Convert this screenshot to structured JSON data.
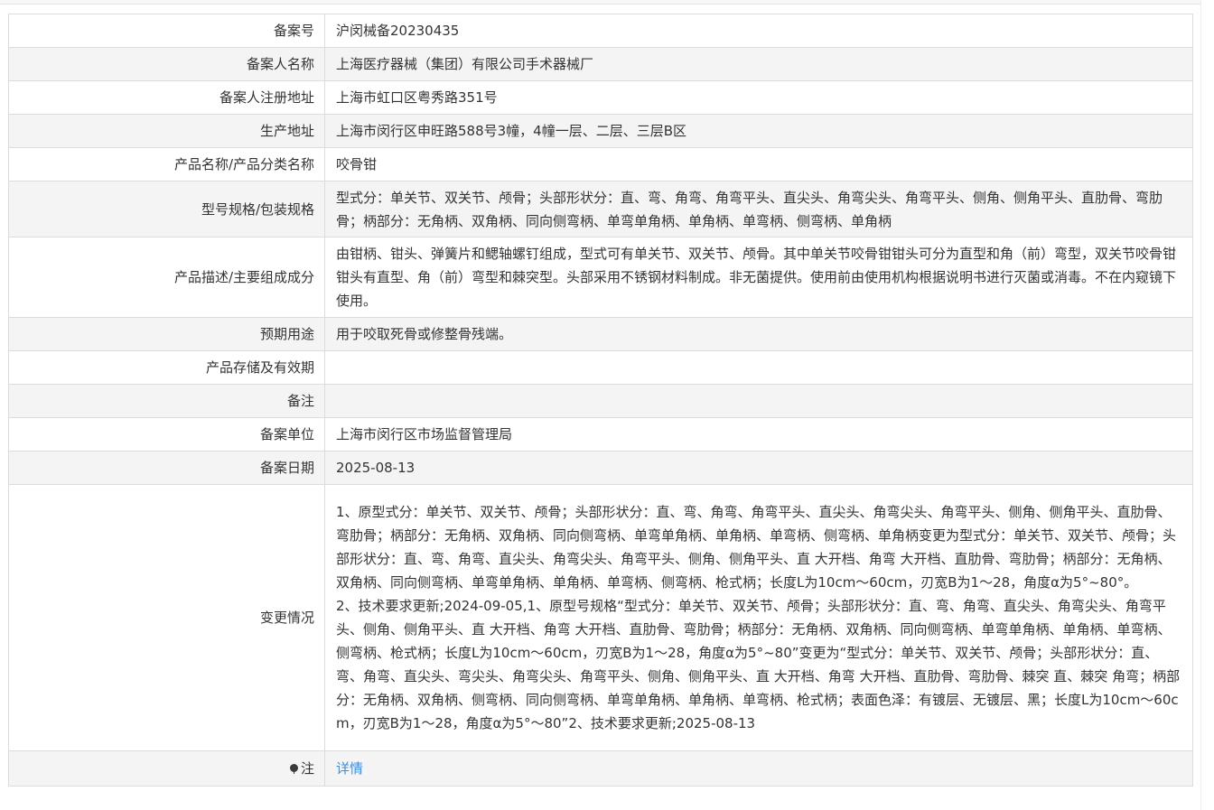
{
  "rows": [
    {
      "label": "备案号",
      "value": "沪闵械备20230435"
    },
    {
      "label": "备案人名称",
      "value": "上海医疗器械（集团）有限公司手术器械厂"
    },
    {
      "label": "备案人注册地址",
      "value": "上海市虹口区粤秀路351号"
    },
    {
      "label": "生产地址",
      "value": "上海市闵行区申旺路588号3幢，4幢一层、二层、三层B区"
    },
    {
      "label": "产品名称/产品分类名称",
      "value": "咬骨钳"
    },
    {
      "label": "型号规格/包装规格",
      "value": "型式分：单关节、双关节、颅骨；头部形状分：直、弯、角弯、角弯平头、直尖头、角弯尖头、角弯平头、侧角、侧角平头、直肋骨、弯肋骨；柄部分：无角柄、双角柄、同向侧弯柄、单弯单角柄、单角柄、单弯柄、侧弯柄、单角柄"
    },
    {
      "label": "产品描述/主要组成成分",
      "value": "由钳柄、钳头、弹簧片和鳃轴螺钉组成，型式可有单关节、双关节、颅骨。其中单关节咬骨钳钳头可分为直型和角（前）弯型，双关节咬骨钳钳头有直型、角（前）弯型和棘突型。头部采用不锈钢材料制成。非无菌提供。使用前由使用机构根据说明书进行灭菌或消毒。不在内窥镜下使用。"
    },
    {
      "label": "预期用途",
      "value": "用于咬取死骨或修整骨残端。"
    },
    {
      "label": "产品存储及有效期",
      "value": ""
    },
    {
      "label": "备注",
      "value": ""
    },
    {
      "label": "备案单位",
      "value": "上海市闵行区市场监督管理局"
    },
    {
      "label": "备案日期",
      "value": "2025-08-13"
    }
  ],
  "changes": {
    "label": "变更情况",
    "item1": "1、原型式分：单关节、双关节、颅骨；头部形状分：直、弯、角弯、角弯平头、直尖头、角弯尖头、角弯平头、侧角、侧角平头、直肋骨、弯肋骨；柄部分：无角柄、双角柄、同向侧弯柄、单弯单角柄、单角柄、单弯柄、侧弯柄、单角柄变更为型式分：单关节、双关节、颅骨；头部形状分：直、弯、角弯、直尖头、角弯尖头、角弯平头、侧角、侧角平头、直 大开档、角弯 大开档、直肋骨、弯肋骨；柄部分：无角柄、双角柄、同向侧弯柄、单弯单角柄、单角柄、单弯柄、侧弯柄、枪式柄；长度L为10cm～60cm，刃宽B为1～28，角度α为5°~80°。",
    "item2": "2、技术要求更新;2024-09-05,1、原型号规格“型式分：单关节、双关节、颅骨；头部形状分：直、弯、角弯、直尖头、角弯尖头、角弯平头、侧角、侧角平头、直 大开档、角弯 大开档、直肋骨、弯肋骨；柄部分：无角柄、双角柄、同向侧弯柄、单弯单角柄、单角柄、单弯柄、侧弯柄、枪式柄；长度L为10cm～60cm，刃宽B为1～28，角度α为5°~80”变更为“型式分：单关节、双关节、颅骨；头部形状分：直、弯、角弯、直尖头、弯尖头、角弯尖头、角弯平头、侧角、侧角平头、直 大开档、角弯 大开档、直肋骨、弯肋骨、棘突 直、棘突 角弯；柄部分：无角柄、双角柄、侧弯柄、同向侧弯柄、单弯单角柄、单角柄、单弯柄、枪式柄；表面色泽：有镀层、无镀层、黑；长度L为10cm～60cm，刃宽B为1～28，角度α为5°～80”2、技术要求更新;2025-08-13"
  },
  "note": {
    "label": "注",
    "link_text": "详情",
    "icon": "pin-icon"
  }
}
